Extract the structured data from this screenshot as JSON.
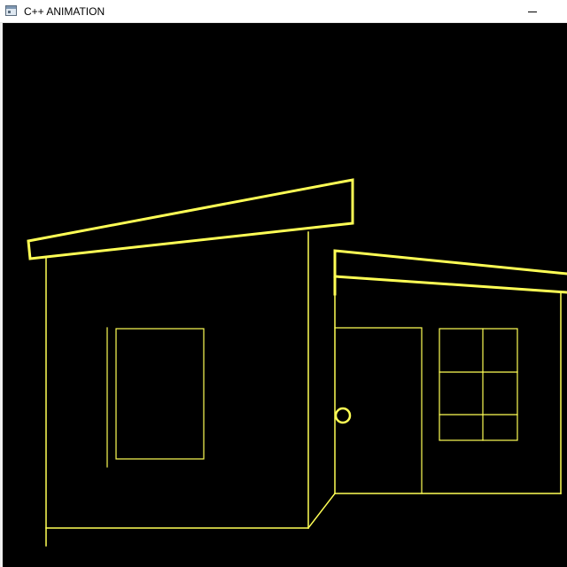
{
  "window": {
    "title": "C++ ANIMATION",
    "icon": "console-window-icon",
    "minimize_icon": "minimize-icon"
  },
  "canvas": {
    "background": "#000000",
    "stroke_color": "#ffff55",
    "scene": "house-line-drawing"
  }
}
